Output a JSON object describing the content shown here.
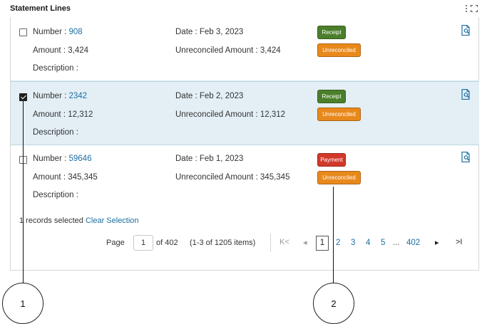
{
  "panel": {
    "title": "Statement Lines"
  },
  "rows": [
    {
      "number_label": "Number :",
      "number": "908",
      "amount_label": "Amount :",
      "amount": "3,424",
      "description_label": "Description :",
      "date_label": "Date :",
      "date": "Feb 3, 2023",
      "unreconciled_label": "Unreconciled Amount :",
      "unreconciled_amount": "3,424",
      "type_badge": "Receipt",
      "status_badge": "Unreconciled",
      "checked": false
    },
    {
      "number_label": "Number :",
      "number": "2342",
      "amount_label": "Amount :",
      "amount": "12,312",
      "description_label": "Description :",
      "date_label": "Date :",
      "date": "Feb 2, 2023",
      "unreconciled_label": "Unreconciled Amount :",
      "unreconciled_amount": "12,312",
      "type_badge": "Receipt",
      "status_badge": "Unreconciled",
      "checked": true
    },
    {
      "number_label": "Number :",
      "number": "59646",
      "amount_label": "Amount :",
      "amount": "345,345",
      "description_label": "Description :",
      "date_label": "Date :",
      "date": "Feb 1, 2023",
      "unreconciled_label": "Unreconciled Amount :",
      "unreconciled_amount": "345,345",
      "type_badge": "Payment",
      "status_badge": "Unreconciled",
      "checked": false
    }
  ],
  "selection": {
    "text": "1 records selected",
    "clear_label": "Clear Selection"
  },
  "pagination": {
    "page_label": "Page",
    "current_page": "1",
    "of_label": "of 402",
    "range_text": "(1-3 of 1205 items)",
    "first_icon": "K<",
    "prev_icon": "◂",
    "pages": [
      "1",
      "2",
      "3",
      "4",
      "5"
    ],
    "ellipsis": "...",
    "last_page": "402",
    "next_icon": "▸",
    "last_icon": ">I"
  },
  "callouts": {
    "one": "1",
    "two": "2"
  },
  "colors": {
    "receipt": "#4b7f2b",
    "payment": "#d2392a",
    "unreconciled": "#e8891c",
    "link": "#1a6fa3",
    "selected_row": "#e3eff5"
  }
}
